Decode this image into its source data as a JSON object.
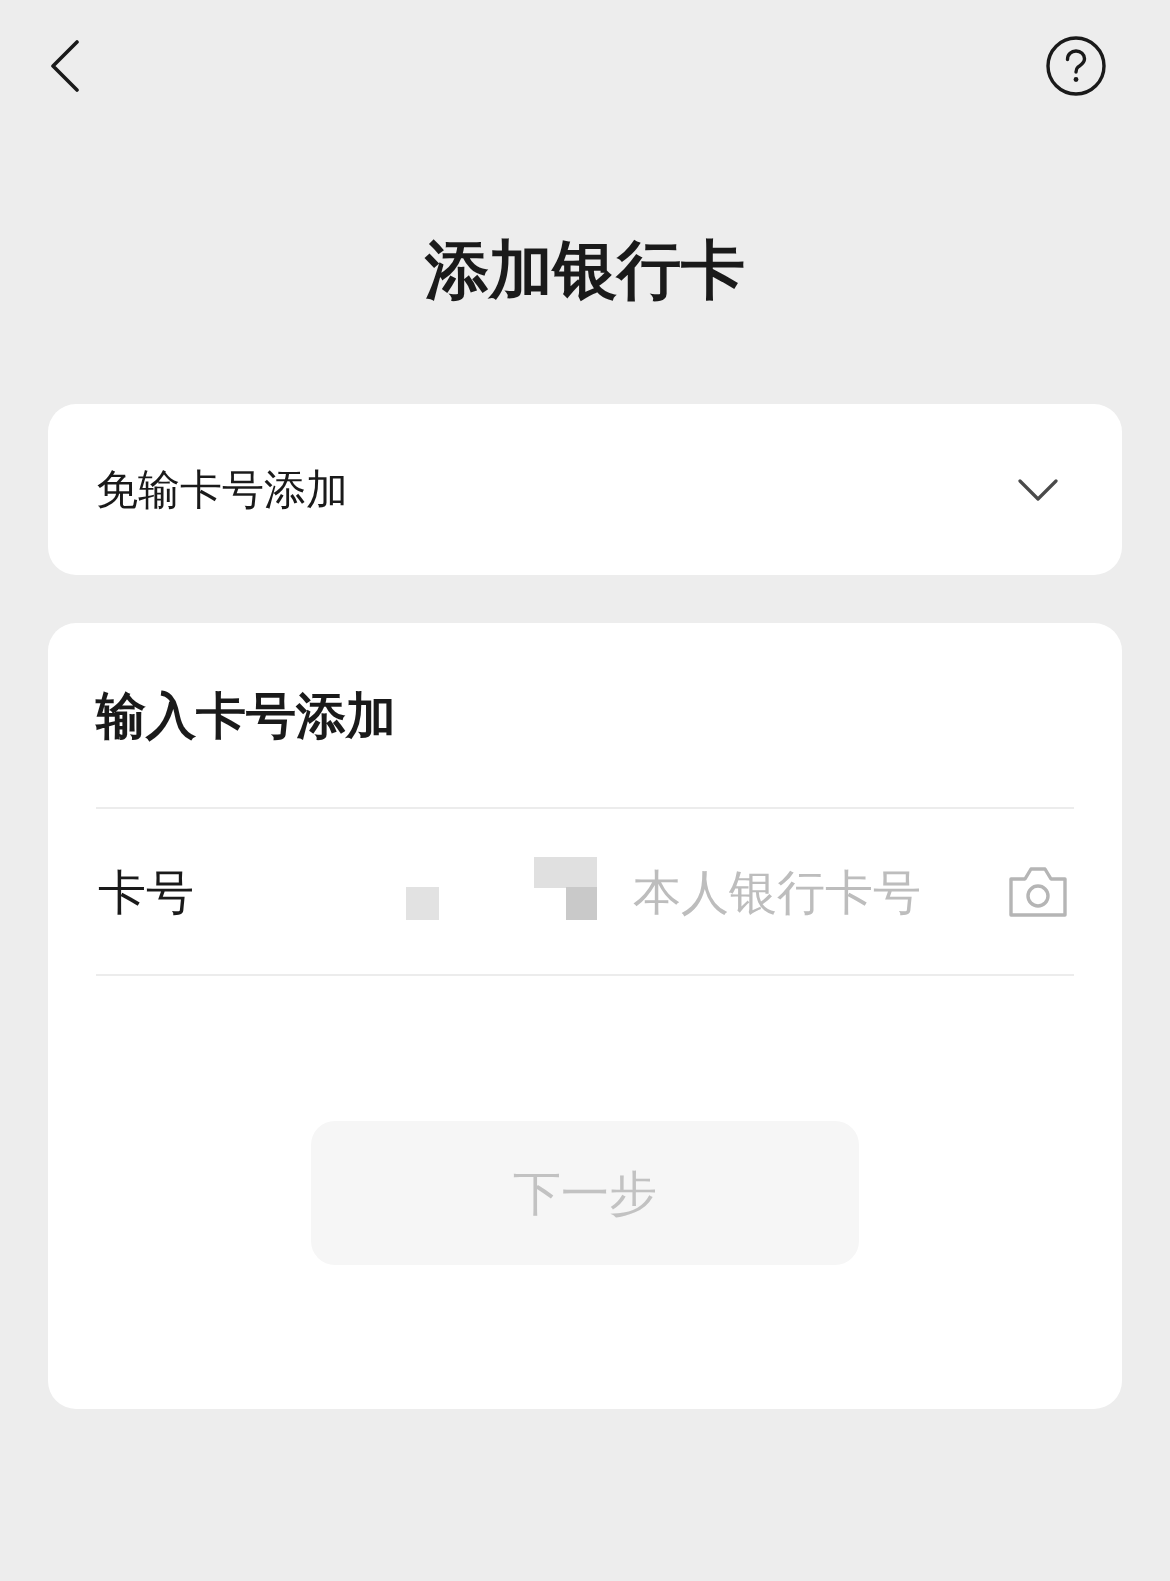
{
  "header": {
    "title": "添加银行卡"
  },
  "quick_add": {
    "label": "免输卡号添加",
    "expanded": false
  },
  "manual_add": {
    "title": "输入卡号添加",
    "fields": [
      {
        "label": "卡号",
        "placeholder": "本人银行卡号"
      }
    ],
    "next_button": {
      "label": "下一步",
      "disabled": true
    }
  }
}
